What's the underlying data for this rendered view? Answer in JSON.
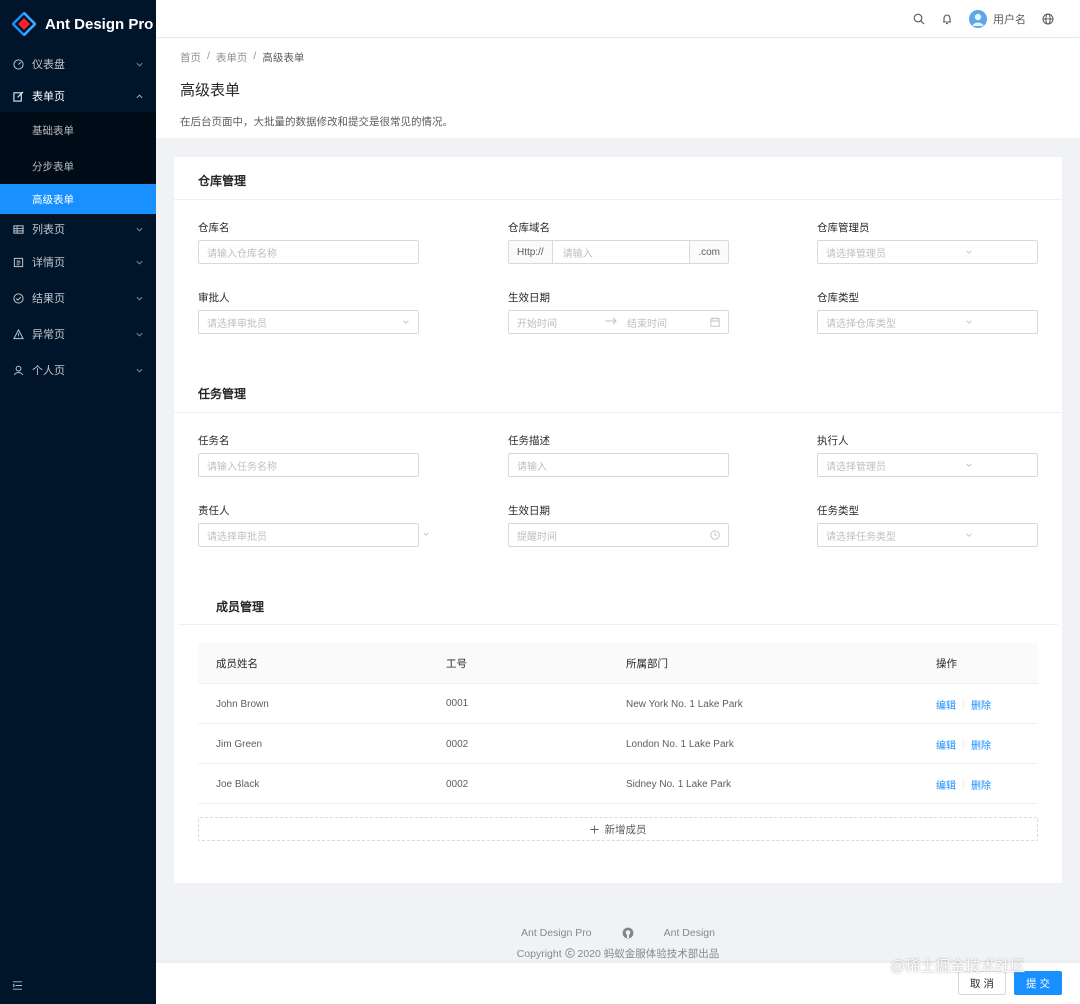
{
  "app": {
    "title": "Ant Design Pro"
  },
  "sidebar": {
    "items": [
      {
        "label": "仪表盘",
        "icon": "dashboard-icon"
      },
      {
        "label": "表单页",
        "icon": "form-icon",
        "open": true,
        "children": [
          "基础表单",
          "分步表单",
          "高级表单"
        ],
        "active_child": "高级表单"
      },
      {
        "label": "列表页",
        "icon": "table-icon"
      },
      {
        "label": "详情页",
        "icon": "profile-icon"
      },
      {
        "label": "结果页",
        "icon": "check-circle-icon"
      },
      {
        "label": "异常页",
        "icon": "warning-icon"
      },
      {
        "label": "个人页",
        "icon": "user-icon"
      }
    ]
  },
  "header": {
    "username": "用户名",
    "icons": [
      "search-icon",
      "bell-icon",
      "globe-icon"
    ]
  },
  "breadcrumb": [
    "首页",
    "/",
    "表单页",
    "/",
    "高级表单"
  ],
  "page": {
    "title": "高级表单",
    "description": "在后台页面中，大批量的数据修改和提交是很常见的情况。"
  },
  "warehouse": {
    "title": "仓库管理",
    "name_label": "仓库名",
    "name_placeholder": "请输入仓库名称",
    "domain_label": "仓库域名",
    "domain_prefix": "Http://",
    "domain_placeholder": "请输入",
    "domain_suffix": ".com",
    "admin_label": "仓库管理员",
    "admin_placeholder": "请选择管理员",
    "approver_label": "审批人",
    "approver_placeholder": "请选择审批员",
    "date_label": "生效日期",
    "date_start": "开始时间",
    "date_end": "结束时间",
    "type_label": "仓库类型",
    "type_placeholder": "请选择仓库类型"
  },
  "task": {
    "title": "任务管理",
    "name_label": "任务名",
    "name_placeholder": "请输入任务名称",
    "desc_label": "任务描述",
    "desc_placeholder": "请输入",
    "executor_label": "执行人",
    "executor_placeholder": "请选择管理员",
    "owner_label": "责任人",
    "owner_placeholder": "请选择审批员",
    "date_label": "生效日期",
    "date_placeholder": "提醒时间",
    "type_label": "任务类型",
    "type_placeholder": "请选择任务类型"
  },
  "members": {
    "title": "成员管理",
    "columns": [
      "成员姓名",
      "工号",
      "所属部门",
      "操作"
    ],
    "rows": [
      {
        "name": "John Brown",
        "id": "0001",
        "dept": "New York No. 1 Lake Park"
      },
      {
        "name": "Jim Green",
        "id": "0002",
        "dept": "London No. 1 Lake Park"
      },
      {
        "name": "Joe Black",
        "id": "0002",
        "dept": "Sidney No. 1 Lake Park"
      }
    ],
    "edit_label": "编辑",
    "delete_label": "删除",
    "add_label": "新增成员"
  },
  "footer": {
    "link1": "Ant Design Pro",
    "link2": "Ant Design",
    "copyright": "Copyright",
    "copyright_text": "2020 蚂蚁金服体验技术部出品"
  },
  "toolbar": {
    "cancel_label": "取 消",
    "submit_label": "提 交"
  },
  "watermark": "@稀土掘金技术社区",
  "colors": {
    "primary": "#1890ff",
    "sider": "#001529",
    "sub_menu": "#000c17"
  }
}
